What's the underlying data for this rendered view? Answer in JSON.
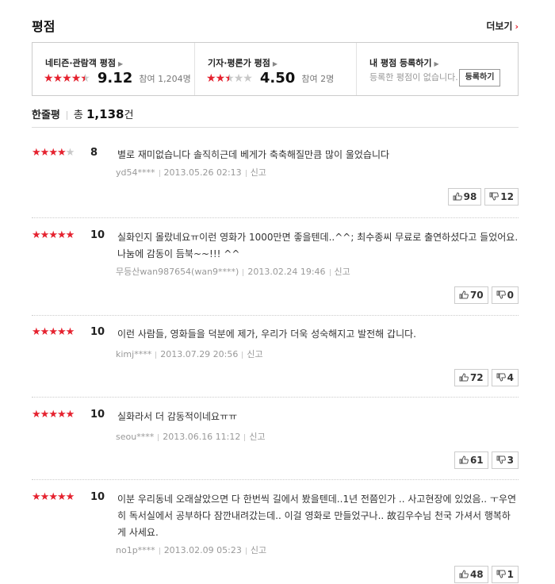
{
  "header": {
    "title": "평점",
    "more": "더보기",
    "more_arrow": "›"
  },
  "summary": {
    "netizen": {
      "label": "네티즌·관람객 평점",
      "score": "9.12",
      "count": "참여 1,204명",
      "stars": 4.5
    },
    "critic": {
      "label": "기자·평론가 평점",
      "score": "4.50",
      "count": "참여 2명",
      "stars": 2.5
    },
    "mine": {
      "label": "내 평점 등록하기",
      "empty": "등록한 평점이 없습니다.",
      "button": "등록하기"
    }
  },
  "comments": {
    "label": "한줄평",
    "total_prefix": "총",
    "total": "1,138",
    "total_suffix": "건"
  },
  "reviews": [
    {
      "stars": 4,
      "score": "8",
      "text": "별로 재미없습니다 솔직히근데 베게가 축축해질만큼 많이 울었습니다",
      "user": "yd54****",
      "date": "2013.05.26 02:13",
      "report": "신고",
      "up": "98",
      "down": "12"
    },
    {
      "stars": 5,
      "score": "10",
      "text": "실화인지 몰랐네요ㅠ이런 영화가 1000만면 좋을텐데..^^; 최수종씨 무료로 출연하셨다고 들었어요. 나눔에 감동이 듬북~~!!! ^^",
      "user": "무등산wan987654(wan9****)",
      "date": "2013.02.24 19:46",
      "report": "신고",
      "up": "70",
      "down": "0"
    },
    {
      "stars": 5,
      "score": "10",
      "text": "이런 사람들, 영화들을 덕분에 제가, 우리가 더욱 성숙해지고 발전해 갑니다.",
      "user": "kimj****",
      "date": "2013.07.29 20:56",
      "report": "신고",
      "up": "72",
      "down": "4"
    },
    {
      "stars": 5,
      "score": "10",
      "text": "실화라서 더 감동적이네요ㅠㅠ",
      "user": "seou****",
      "date": "2013.06.16 11:12",
      "report": "신고",
      "up": "61",
      "down": "3"
    },
    {
      "stars": 5,
      "score": "10",
      "text": "이분 우리동네 오래살았으면 다 한번씩 길에서 봤을텐데..1년 전쯤인가 .. 사고현장에 있었음.. ㅜ우연히 독서실에서 공부하다 잠깐내려갔는데.. 이걸 영화로 만들었구나.. 故김우수님 천국 가셔서 행복하게 사세요.",
      "user": "no1p****",
      "date": "2013.02.09 05:23",
      "report": "신고",
      "up": "48",
      "down": "1"
    }
  ],
  "colors": {
    "accent": "#e5222f",
    "star_off": "#c8c8c8"
  }
}
